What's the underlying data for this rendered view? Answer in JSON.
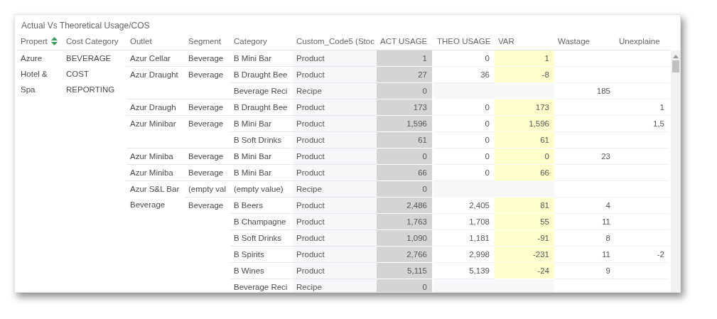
{
  "panel": {
    "title": "Actual Vs Theoretical Usage/COS"
  },
  "table": {
    "columns": [
      "Propert",
      "Cost Category",
      "Outlet",
      "Segment",
      "Category",
      "Custom_Code5 (Stoc",
      "ACT USAGE",
      "THEO USAGE",
      "VAR",
      "Wastage",
      "Unexplaine"
    ],
    "property": "Azure Hotel & Spa",
    "cost_category": "BEVERAGE COST REPORTING",
    "outlets": [
      {
        "name": "Azur Cellar",
        "segments": [
          {
            "name": "Beverage",
            "rows": [
              {
                "category": "B Mini Bar",
                "custom_code5": "Product",
                "act_usage": "1",
                "theo_usage": "0",
                "var": "1"
              }
            ]
          }
        ]
      },
      {
        "name": "Azur Draught",
        "segments": [
          {
            "name": "Beverage",
            "rows": [
              {
                "category": "B Draught Bee",
                "custom_code5": "Product",
                "act_usage": "27",
                "theo_usage": "36",
                "var": "-8"
              },
              {
                "category": "Beverage Reci",
                "custom_code5": "Recipe",
                "act_usage": "0",
                "wastage": "185"
              }
            ]
          }
        ]
      },
      {
        "name": "Azur Draugh",
        "segments": [
          {
            "name": "Beverage",
            "rows": [
              {
                "category": "B Draught Bee",
                "custom_code5": "Product",
                "act_usage": "173",
                "theo_usage": "0",
                "var": "173",
                "unexplained": "1"
              }
            ]
          }
        ]
      },
      {
        "name": "Azur Minibar",
        "segments": [
          {
            "name": "Beverage",
            "rows": [
              {
                "category": "B Mini Bar",
                "custom_code5": "Product",
                "act_usage": "1,596",
                "theo_usage": "0",
                "var": "1,596",
                "unexplained": "1,5"
              },
              {
                "category": "B Soft Drinks",
                "custom_code5": "Product",
                "act_usage": "61",
                "theo_usage": "0",
                "var": "61"
              }
            ]
          }
        ]
      },
      {
        "name": "Azur Miniba",
        "segments": [
          {
            "name": "Beverage",
            "rows": [
              {
                "category": "B Mini Bar",
                "custom_code5": "Product",
                "act_usage": "0",
                "theo_usage": "0",
                "var": "0",
                "wastage": "23"
              }
            ]
          }
        ]
      },
      {
        "name": "Azur Miniba",
        "segments": [
          {
            "name": "Beverage",
            "rows": [
              {
                "category": "B Mini Bar",
                "custom_code5": "Product",
                "act_usage": "66",
                "theo_usage": "0",
                "var": "66"
              }
            ]
          }
        ]
      },
      {
        "name": "Azur S&L Bar Beverage",
        "segments": [
          {
            "name": "(empty val",
            "rows": [
              {
                "category": "(empty value)",
                "custom_code5": "Recipe",
                "act_usage": "0"
              }
            ]
          },
          {
            "name": "Beverage",
            "rows": [
              {
                "category": "B Beers",
                "custom_code5": "Product",
                "act_usage": "2,486",
                "theo_usage": "2,405",
                "var": "81",
                "wastage": "4"
              },
              {
                "category": "B Champagne",
                "custom_code5": "Product",
                "act_usage": "1,763",
                "theo_usage": "1,708",
                "var": "55",
                "wastage": "11"
              },
              {
                "category": "B Soft Drinks",
                "custom_code5": "Product",
                "act_usage": "1,090",
                "theo_usage": "1,181",
                "var": "-91",
                "wastage": "8"
              },
              {
                "category": "B Spirits",
                "custom_code5": "Product",
                "act_usage": "2,766",
                "theo_usage": "2,998",
                "var": "-231",
                "wastage": "11",
                "unexplained": "-2"
              },
              {
                "category": "B Wines",
                "custom_code5": "Product",
                "act_usage": "5,115",
                "theo_usage": "5,139",
                "var": "-24",
                "wastage": "9"
              },
              {
                "category": "Beverage Reci",
                "custom_code5": "Recipe",
                "act_usage": "0"
              }
            ]
          }
        ]
      }
    ]
  }
}
